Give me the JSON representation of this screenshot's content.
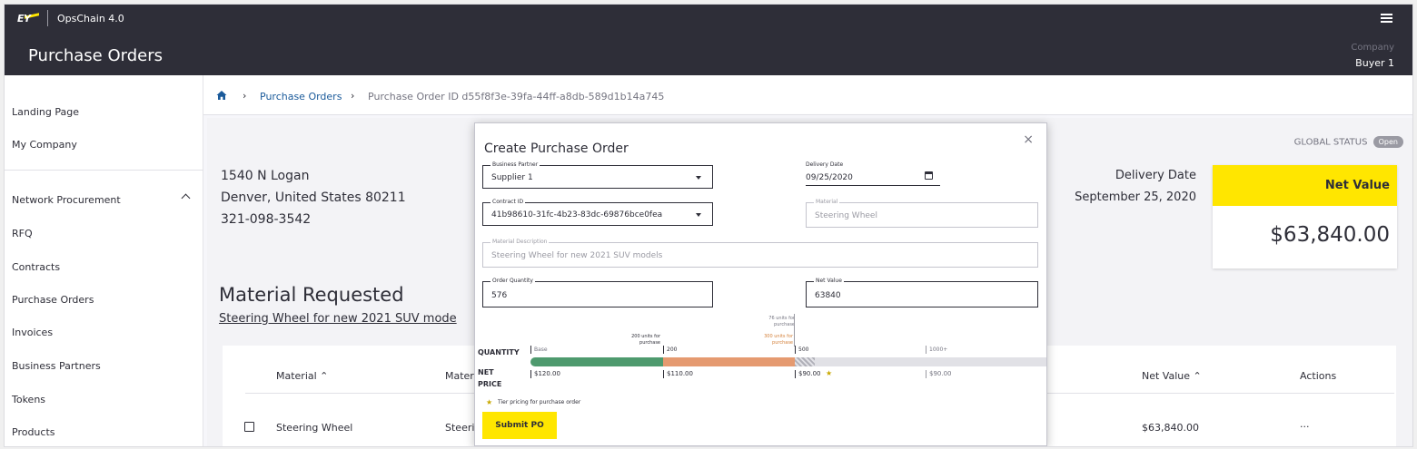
{
  "header": {
    "logo_text": "EY",
    "app_name": "OpsChain 4.0",
    "page_title": "Purchase Orders",
    "company_label": "Company",
    "company_value": "Buyer 1"
  },
  "sidebar": {
    "items": [
      {
        "label": "Landing Page"
      },
      {
        "label": "My Company"
      },
      {
        "label": "Network Procurement"
      },
      {
        "label": "RFQ"
      },
      {
        "label": "Contracts"
      },
      {
        "label": "Purchase Orders"
      },
      {
        "label": "Invoices"
      },
      {
        "label": "Business Partners"
      },
      {
        "label": "Tokens"
      },
      {
        "label": "Products"
      }
    ]
  },
  "breadcrumb": {
    "link": "Purchase Orders",
    "current": "Purchase Order ID d55f8f3e-39fa-44ff-a8db-589d1b14a745"
  },
  "order": {
    "address_line1": "1540 N Logan",
    "address_line2": "Denver, United States 80211",
    "phone": "321-098-3542",
    "global_status_label": "GLOBAL STATUS",
    "global_status": "Open",
    "delivery_date_label": "Delivery Date",
    "delivery_date": "September 25, 2020",
    "net_value_label": "Net Value",
    "net_value": "$63,840.00",
    "material_title": "Material Requested",
    "material_link": "Steering Wheel for new 2021 SUV mode"
  },
  "table": {
    "headers": {
      "material": "Material ⌃",
      "material2": "Materi",
      "net_value": "Net Value ⌃",
      "actions": "Actions"
    },
    "row": {
      "material": "Steering Wheel",
      "material2": "Steeri",
      "net_value": "$63,840.00",
      "actions": "..."
    }
  },
  "modal": {
    "title": "Create Purchase Order",
    "close": "×",
    "business_partner": {
      "label": "Business Partner",
      "value": "Supplier 1"
    },
    "delivery_date": {
      "label": "Delivery Date",
      "value": "09/25/2020"
    },
    "contract_id": {
      "label": "Contract ID",
      "value": "41b98610-31fc-4b23-83dc-69876bce0fea"
    },
    "material": {
      "label": "Material",
      "value": "Steering Wheel"
    },
    "material_description": {
      "label": "Material Description",
      "value": "Steering Wheel for new 2021 SUV models"
    },
    "order_quantity": {
      "label": "Order Quantity",
      "value": "576"
    },
    "net_value": {
      "label": "Net Value",
      "value": "63840"
    },
    "tier": {
      "quantity_label": "QUANTITY",
      "net_label_1": "NET",
      "net_label_2": "PRICE",
      "tiers": [
        {
          "qty": "Base",
          "price": "$120.00"
        },
        {
          "qty": "200",
          "price": "$110.00"
        },
        {
          "qty": "500",
          "price": "$90.00"
        },
        {
          "qty": "1000+",
          "price": "$90.00"
        }
      ],
      "note_200": "200 units for purchase",
      "note_300": "300 units for purchase",
      "note_76": "76 units for purchase",
      "star_glyph": "★",
      "tier_note": "Tier pricing for purchase order"
    },
    "submit_label": "Submit PO"
  },
  "colors": {
    "header_bg": "#2e2e38",
    "accent_yellow": "#ffe600",
    "tier_green": "#4e9a6e",
    "tier_orange": "#e59a70"
  }
}
